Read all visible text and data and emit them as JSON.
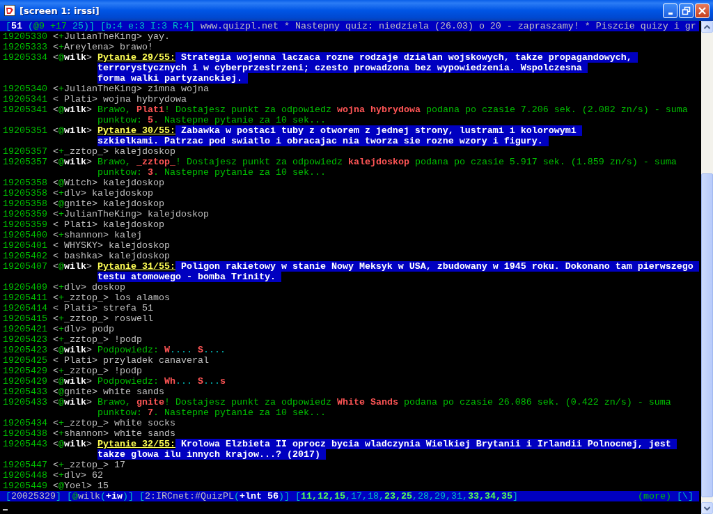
{
  "window": {
    "title": "[screen 1: irssi]"
  },
  "topic_bar": [
    {
      "t": "[",
      "kind": "c"
    },
    {
      "t": "51",
      "kind": "w"
    },
    {
      "t": " (",
      "kind": "c"
    },
    {
      "t": "@9",
      "kind": "g"
    },
    {
      "t": " +17",
      "kind": "g"
    },
    {
      "t": " 25)]",
      "kind": "c"
    },
    {
      "t": " [b:4 e:3 I:3 R:4]",
      "kind": "c"
    },
    {
      "t": " www.quizpl.net * Nastepny quiz: niedziela (26.03) o 20 - zapraszamy! * Piszcie quizy i gr",
      "kind": "p"
    }
  ],
  "nick_brackets": [
    "<",
    ">"
  ],
  "messages": [
    {
      "time": "19205330",
      "mode": "+",
      "nick": "JulianTheKing",
      "highlight": false,
      "lines": [
        [
          {
            "t": "yay.",
            "kind": "p"
          }
        ]
      ]
    },
    {
      "time": "19205333",
      "mode": "+",
      "nick": "Areylena",
      "highlight": false,
      "lines": [
        [
          {
            "t": "brawo!",
            "kind": "p"
          }
        ]
      ]
    },
    {
      "time": "19205334",
      "mode": "@",
      "nick": "wilk",
      "highlight": true,
      "lines": [
        [
          {
            "t": "Pytanie 29/55:",
            "kind": "label"
          },
          {
            "t": "Strategia wojenna laczaca rozne rodzaje dzialan wojskowych, takze propagandowych,",
            "kind": "q"
          }
        ],
        [
          {
            "t": "terrorystycznych i w cyberprzestrzeni; czesto prowadzona bez wypowiedzenia. Wspolczesna",
            "kind": "q"
          }
        ],
        [
          {
            "t": "forma walki partyzanckiej.",
            "kind": "q"
          }
        ]
      ]
    },
    {
      "time": "19205340",
      "mode": "+",
      "nick": "JulianTheKing",
      "highlight": false,
      "lines": [
        [
          {
            "t": "zimna wojna",
            "kind": "p"
          }
        ]
      ]
    },
    {
      "time": "19205341",
      "nick": "Plati",
      "highlight": false,
      "lines": [
        [
          {
            "t": "wojna hybrydowa",
            "kind": "p"
          }
        ]
      ]
    },
    {
      "time": "19205341",
      "mode": "@",
      "nick": "wilk",
      "highlight": true,
      "lines": [
        [
          {
            "t": "Brawo, ",
            "kind": "g"
          },
          {
            "t": "Plati",
            "kind": "r"
          },
          {
            "t": "! Dostajesz punkt za odpowiedz ",
            "kind": "g"
          },
          {
            "t": "wojna hybrydowa",
            "kind": "r"
          },
          {
            "t": " podana po czasie 7.206 sek. (2.082 zn/s) - suma",
            "kind": "g"
          }
        ],
        [
          {
            "t": "punktow: ",
            "kind": "g"
          },
          {
            "t": "5",
            "kind": "r"
          },
          {
            "t": ". Nastepne pytanie za 10 sek...",
            "kind": "g"
          }
        ]
      ]
    },
    {
      "time": "19205351",
      "mode": "@",
      "nick": "wilk",
      "highlight": true,
      "lines": [
        [
          {
            "t": "Pytanie 30/55:",
            "kind": "label"
          },
          {
            "t": "Zabawka w postaci tuby z otworem z jednej strony, lustrami i kolorowymi",
            "kind": "q"
          }
        ],
        [
          {
            "t": "szkielkami. Patrzac pod swiatlo i obracajac nia tworza sie rozne wzory i figury.",
            "kind": "q"
          }
        ]
      ]
    },
    {
      "time": "19205357",
      "mode": "+",
      "nick": "_zztop_",
      "highlight": false,
      "lines": [
        [
          {
            "t": "kalejdoskop",
            "kind": "p"
          }
        ]
      ]
    },
    {
      "time": "19205357",
      "mode": "@",
      "nick": "wilk",
      "highlight": true,
      "lines": [
        [
          {
            "t": "Brawo, ",
            "kind": "g"
          },
          {
            "t": "_zztop_",
            "kind": "r"
          },
          {
            "t": "! Dostajesz punkt za odpowiedz ",
            "kind": "g"
          },
          {
            "t": "kalejdoskop",
            "kind": "r"
          },
          {
            "t": " podana po czasie 5.917 sek. (1.859 zn/s) - suma",
            "kind": "g"
          }
        ],
        [
          {
            "t": "punktow: ",
            "kind": "g"
          },
          {
            "t": "3",
            "kind": "r"
          },
          {
            "t": ". Nastepne pytanie za 10 sek...",
            "kind": "g"
          }
        ]
      ]
    },
    {
      "time": "19205358",
      "mode": "@",
      "nick": "Witch",
      "highlight": false,
      "lines": [
        [
          {
            "t": "kalejdoskop",
            "kind": "p"
          }
        ]
      ]
    },
    {
      "time": "19205358",
      "mode": "+",
      "nick": "dlv",
      "highlight": false,
      "lines": [
        [
          {
            "t": "kalejdoskop",
            "kind": "p"
          }
        ]
      ]
    },
    {
      "time": "19205358",
      "mode": "@",
      "nick": "gnite",
      "highlight": false,
      "lines": [
        [
          {
            "t": "kalejdoskop",
            "kind": "p"
          }
        ]
      ]
    },
    {
      "time": "19205359",
      "mode": "+",
      "nick": "JulianTheKing",
      "highlight": false,
      "lines": [
        [
          {
            "t": "kalejdoskop",
            "kind": "p"
          }
        ]
      ]
    },
    {
      "time": "19205359",
      "nick": "Plati",
      "highlight": false,
      "lines": [
        [
          {
            "t": "kalejdoskop",
            "kind": "p"
          }
        ]
      ]
    },
    {
      "time": "19205400",
      "mode": "+",
      "nick": "shannon",
      "highlight": false,
      "lines": [
        [
          {
            "t": "kalej",
            "kind": "p"
          }
        ]
      ]
    },
    {
      "time": "19205401",
      "nick": "WHYSKY",
      "highlight": false,
      "lines": [
        [
          {
            "t": "kalejdoskop",
            "kind": "p"
          }
        ]
      ]
    },
    {
      "time": "19205402",
      "nick": "bashka",
      "highlight": false,
      "lines": [
        [
          {
            "t": "kalejdoskop",
            "kind": "p"
          }
        ]
      ]
    },
    {
      "time": "19205407",
      "mode": "@",
      "nick": "wilk",
      "highlight": true,
      "lines": [
        [
          {
            "t": "Pytanie 31/55:",
            "kind": "label"
          },
          {
            "t": "Poligon rakietowy w stanie Nowy Meksyk w USA, zbudowany w 1945 roku. Dokonano tam pierwszego",
            "kind": "q"
          }
        ],
        [
          {
            "t": "testu atomowego - bomba Trinity.",
            "kind": "q"
          }
        ]
      ]
    },
    {
      "time": "19205409",
      "mode": "+",
      "nick": "dlv",
      "highlight": false,
      "lines": [
        [
          {
            "t": "doskop",
            "kind": "p"
          }
        ]
      ]
    },
    {
      "time": "19205411",
      "mode": "+",
      "nick": "_zztop_",
      "highlight": false,
      "lines": [
        [
          {
            "t": "los alamos",
            "kind": "p"
          }
        ]
      ]
    },
    {
      "time": "19205414",
      "nick": "Plati",
      "highlight": false,
      "lines": [
        [
          {
            "t": "strefa 51",
            "kind": "p"
          }
        ]
      ]
    },
    {
      "time": "19205415",
      "mode": "+",
      "nick": "_zztop_",
      "highlight": false,
      "lines": [
        [
          {
            "t": "roswell",
            "kind": "p"
          }
        ]
      ]
    },
    {
      "time": "19205421",
      "mode": "+",
      "nick": "dlv",
      "highlight": false,
      "lines": [
        [
          {
            "t": "podp",
            "kind": "p"
          }
        ]
      ]
    },
    {
      "time": "19205423",
      "mode": "+",
      "nick": "_zztop_",
      "highlight": false,
      "lines": [
        [
          {
            "t": "!podp",
            "kind": "p"
          }
        ]
      ]
    },
    {
      "time": "19205423",
      "mode": "@",
      "nick": "wilk",
      "highlight": true,
      "lines": [
        [
          {
            "t": "Podpowiedz: ",
            "kind": "g"
          },
          {
            "t": "W",
            "kind": "r"
          },
          {
            "t": "....",
            "kind": "c"
          },
          {
            "t": " S",
            "kind": "r"
          },
          {
            "t": "....",
            "kind": "c"
          }
        ]
      ]
    },
    {
      "time": "19205425",
      "nick": "Plati",
      "highlight": false,
      "lines": [
        [
          {
            "t": "przyladek canaveral",
            "kind": "p"
          }
        ]
      ]
    },
    {
      "time": "19205429",
      "mode": "+",
      "nick": "_zztop_",
      "highlight": false,
      "lines": [
        [
          {
            "t": "!podp",
            "kind": "p"
          }
        ]
      ]
    },
    {
      "time": "19205429",
      "mode": "@",
      "nick": "wilk",
      "highlight": true,
      "lines": [
        [
          {
            "t": "Podpowiedz: ",
            "kind": "g"
          },
          {
            "t": "Wh",
            "kind": "r"
          },
          {
            "t": "...",
            "kind": "c"
          },
          {
            "t": " S",
            "kind": "r"
          },
          {
            "t": "...",
            "kind": "c"
          },
          {
            "t": "s",
            "kind": "r"
          }
        ]
      ]
    },
    {
      "time": "19205433",
      "mode": "@",
      "nick": "gnite",
      "highlight": false,
      "lines": [
        [
          {
            "t": "white sands",
            "kind": "p"
          }
        ]
      ]
    },
    {
      "time": "19205433",
      "mode": "@",
      "nick": "wilk",
      "highlight": true,
      "lines": [
        [
          {
            "t": "Brawo, ",
            "kind": "g"
          },
          {
            "t": "gnite",
            "kind": "r"
          },
          {
            "t": "! Dostajesz punkt za odpowiedz ",
            "kind": "g"
          },
          {
            "t": "White Sands",
            "kind": "r"
          },
          {
            "t": " podana po czasie 26.086 sek. (0.422 zn/s) - suma",
            "kind": "g"
          }
        ],
        [
          {
            "t": "punktow: ",
            "kind": "g"
          },
          {
            "t": "7",
            "kind": "r"
          },
          {
            "t": ". Nastepne pytanie za 10 sek...",
            "kind": "g"
          }
        ]
      ]
    },
    {
      "time": "19205434",
      "mode": "+",
      "nick": "_zztop_",
      "highlight": false,
      "lines": [
        [
          {
            "t": "white socks",
            "kind": "p"
          }
        ]
      ]
    },
    {
      "time": "19205438",
      "mode": "+",
      "nick": "shannon",
      "highlight": false,
      "lines": [
        [
          {
            "t": "white sands",
            "kind": "p"
          }
        ]
      ]
    },
    {
      "time": "19205443",
      "mode": "@",
      "nick": "wilk",
      "highlight": true,
      "lines": [
        [
          {
            "t": "Pytanie 32/55:",
            "kind": "label"
          },
          {
            "t": "Krolowa Elzbieta II oprocz bycia wladczynia Wielkiej Brytanii i Irlandii Polnocnej, jest",
            "kind": "q"
          }
        ],
        [
          {
            "t": "takze glowa ilu innych krajow...? (2017)",
            "kind": "q"
          }
        ]
      ]
    },
    {
      "time": "19205447",
      "mode": "+",
      "nick": "_zztop_",
      "highlight": false,
      "lines": [
        [
          {
            "t": "17",
            "kind": "p"
          }
        ]
      ]
    },
    {
      "time": "19205448",
      "mode": "+",
      "nick": "dlv",
      "highlight": false,
      "lines": [
        [
          {
            "t": "62",
            "kind": "p"
          }
        ]
      ]
    },
    {
      "time": "19205449",
      "mode": "@",
      "nick": "Yoel",
      "highlight": false,
      "lines": [
        [
          {
            "t": "15",
            "kind": "p"
          }
        ]
      ]
    }
  ],
  "status_bar": {
    "left": [
      [
        {
          "t": "[",
          "kind": "c"
        },
        {
          "t": "20025329",
          "kind": "p"
        },
        {
          "t": "]",
          "kind": "c"
        }
      ],
      [
        {
          "t": "[",
          "kind": "c"
        },
        {
          "t": "@",
          "kind": "g"
        },
        {
          "t": "wilk",
          "kind": "p"
        },
        {
          "t": "(",
          "kind": "c"
        },
        {
          "t": "+iw",
          "kind": "w"
        },
        {
          "t": ")]",
          "kind": "c"
        }
      ],
      [
        {
          "t": "[",
          "kind": "c"
        },
        {
          "t": "2:IRCnet:#QuizPL",
          "kind": "p"
        },
        {
          "t": "(",
          "kind": "c"
        },
        {
          "t": "+lnt 56",
          "kind": "w"
        },
        {
          "t": ")]",
          "kind": "c"
        }
      ],
      [
        {
          "t": "[",
          "kind": "c"
        },
        {
          "t": "11,12,15",
          "kind": "gb"
        },
        {
          "t": ",17,18,",
          "kind": "c"
        },
        {
          "t": "23,25",
          "kind": "gb"
        },
        {
          "t": ",28,29,31,",
          "kind": "c"
        },
        {
          "t": "33,34,35",
          "kind": "gb"
        },
        {
          "t": "]",
          "kind": "c"
        }
      ]
    ],
    "right": [
      [
        {
          "t": "(more)",
          "kind": "g"
        }
      ],
      [
        {
          "t": "[\\]",
          "kind": "c"
        }
      ]
    ]
  }
}
